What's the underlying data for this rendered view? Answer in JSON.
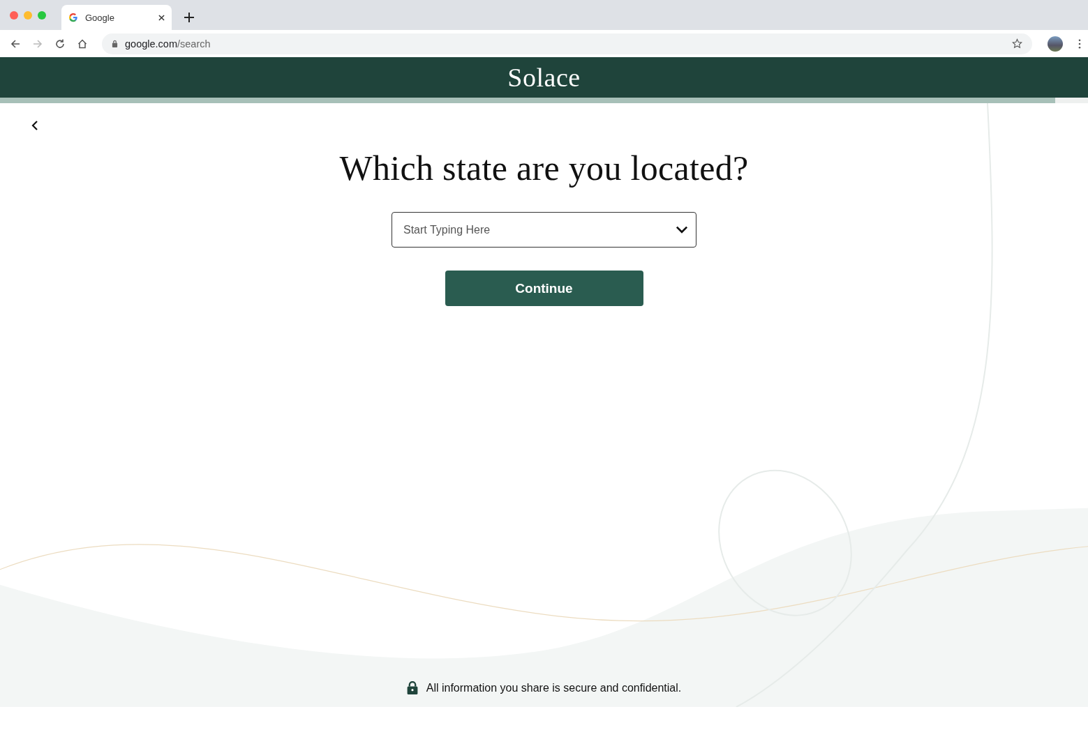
{
  "browser": {
    "tab": {
      "title": "Google",
      "selected": true
    },
    "url": {
      "host": "google.com",
      "path": "/search"
    }
  },
  "header": {
    "logo": "Solace"
  },
  "progress": {
    "level": 0.97
  },
  "question": {
    "title": "Which state are you located?",
    "field": {
      "placeholder": "Start Typing Here"
    },
    "button": "Continue"
  },
  "footer": {
    "note": "All information you share is secure and confidential."
  }
}
